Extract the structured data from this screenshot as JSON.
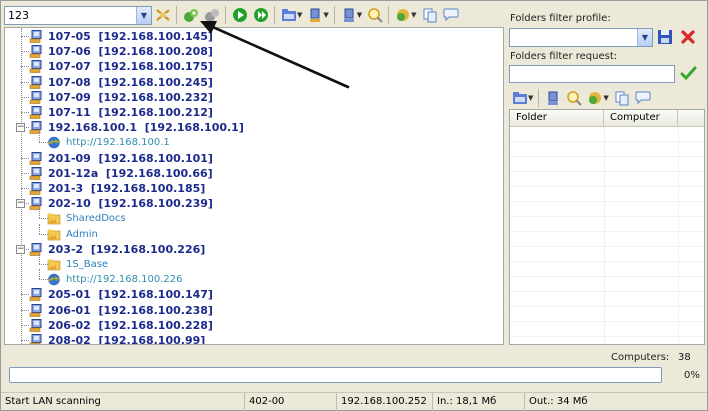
{
  "toolbar": {
    "combo_value": "123",
    "buttons": [
      {
        "name": "cancel-scan-icon",
        "color": "#c89a2a"
      },
      {
        "name": "scan-network-icon",
        "color": "#4aa83a"
      },
      {
        "name": "scan-stop-icon",
        "color": "#8f8f8f"
      },
      {
        "name": "play-icon",
        "color": "#22a02a"
      },
      {
        "name": "forward-icon",
        "color": "#22a02a"
      },
      {
        "name": "folder-view-icon",
        "color": "#3a62c8"
      },
      {
        "name": "computer-view-icon",
        "color": "#3a62c8"
      },
      {
        "name": "filter-icon",
        "color": "#3a62c8"
      },
      {
        "name": "search-icon",
        "color": "#d0a020"
      },
      {
        "name": "options-icon",
        "color": "#d0a020"
      },
      {
        "name": "copy-icon",
        "color": "#5c82c8"
      },
      {
        "name": "chat-icon",
        "color": "#5c82c8"
      }
    ]
  },
  "tree": {
    "items": [
      {
        "type": "computer",
        "label": "107-05  [192.168.100.145]",
        "level": 0
      },
      {
        "type": "computer",
        "label": "107-06  [192.168.100.208]",
        "level": 0
      },
      {
        "type": "computer",
        "label": "107-07  [192.168.100.175]",
        "level": 0
      },
      {
        "type": "computer",
        "label": "107-08  [192.168.100.245]",
        "level": 0
      },
      {
        "type": "computer",
        "label": "107-09  [192.168.100.232]",
        "level": 0
      },
      {
        "type": "computer",
        "label": "107-11  [192.168.100.212]",
        "level": 0
      },
      {
        "type": "computer",
        "label": "192.168.100.1  [192.168.100.1]",
        "level": 0,
        "expanded": true
      },
      {
        "type": "http",
        "label": "http://192.168.100.1",
        "level": 1
      },
      {
        "type": "computer",
        "label": "201-09  [192.168.100.101]",
        "level": 0
      },
      {
        "type": "computer",
        "label": "201-12a  [192.168.100.66]",
        "level": 0
      },
      {
        "type": "computer",
        "label": "201-3  [192.168.100.185]",
        "level": 0
      },
      {
        "type": "computer",
        "label": "202-10  [192.168.100.239]",
        "level": 0,
        "expanded": true
      },
      {
        "type": "share",
        "label": "SharedDocs",
        "level": 1
      },
      {
        "type": "share",
        "label": "Admin",
        "level": 1
      },
      {
        "type": "computer",
        "label": "203-2  [192.168.100.226]",
        "level": 0,
        "expanded": true
      },
      {
        "type": "share",
        "label": "1S_Base",
        "level": 1
      },
      {
        "type": "http",
        "label": "http://192.168.100.226",
        "level": 1
      },
      {
        "type": "computer",
        "label": "205-01  [192.168.100.147]",
        "level": 0
      },
      {
        "type": "computer",
        "label": "206-01  [192.168.100.238]",
        "level": 0
      },
      {
        "type": "computer",
        "label": "206-02  [192.168.100.228]",
        "level": 0
      },
      {
        "type": "computer",
        "label": "208-02  [192.168.100.99]",
        "level": 0
      }
    ]
  },
  "side": {
    "profile_label": "Folders filter profile:",
    "request_label": "Folders filter request:",
    "columns": [
      "Folder",
      "Computer"
    ]
  },
  "bottom": {
    "computers_label": "Computers:",
    "computers_count": "38",
    "progress_percent": 0,
    "progress_text": "0%"
  },
  "status": {
    "cells": [
      "Start LAN scanning",
      "402-00",
      "192.168.100.252",
      "In.: 18,1 Мб",
      "Out.: 34 Мб"
    ]
  },
  "colors": {
    "computer_label": "#1c2a8c",
    "share_label": "#2f7fb8",
    "http_label": "#2f8fb0",
    "annotation_arrow": "#111111"
  }
}
